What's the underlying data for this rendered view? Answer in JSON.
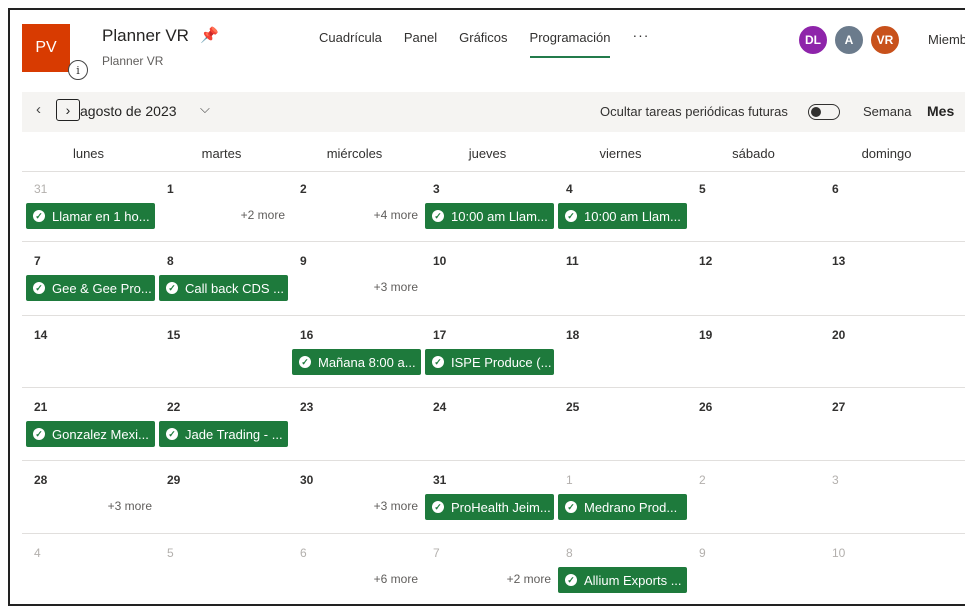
{
  "header": {
    "plan_icon_text": "PV",
    "plan_title": "Planner VR",
    "plan_subtitle": "Planner VR",
    "info_glyph": "i",
    "pin_glyph": "📌",
    "nav": [
      {
        "label": "Cuadrícula"
      },
      {
        "label": "Panel"
      },
      {
        "label": "Gráficos"
      },
      {
        "label": "Programación",
        "active": true
      }
    ],
    "more_glyph": "···",
    "avatars": [
      {
        "initials": "DL",
        "color": "#8e24aa"
      },
      {
        "initials": "A",
        "color": "#6b7b8c"
      },
      {
        "initials": "VR",
        "color": "#c8511b"
      }
    ],
    "members_label": "Miembros"
  },
  "toolbar": {
    "prev_glyph": "‹",
    "next_glyph": "›",
    "month_label": "agosto de 2023",
    "caret_glyph": "⌵",
    "hide_recurring_label": "Ocultar tareas periódicas futuras",
    "hide_recurring_on": false,
    "view_week": "Semana",
    "view_month": "Mes",
    "active_view": "Mes"
  },
  "calendar": {
    "days_of_week": [
      "lunes",
      "martes",
      "miércoles",
      "jueves",
      "viernes",
      "sábado",
      "domingo"
    ],
    "weeks": [
      {
        "days": [
          {
            "num": "31",
            "other": true
          },
          {
            "num": "1"
          },
          {
            "num": "2"
          },
          {
            "num": "3"
          },
          {
            "num": "4"
          },
          {
            "num": "5"
          },
          {
            "num": "6"
          }
        ],
        "more": [
          {
            "col": 1,
            "text": "+2 more"
          },
          {
            "col": 2,
            "text": "+4 more"
          }
        ],
        "tasks": [
          {
            "col": 0,
            "text": "Llamar en 1 ho..."
          },
          {
            "col": 3,
            "text": "10:00 am Llam..."
          },
          {
            "col": 4,
            "text": "10:00 am Llam..."
          }
        ]
      },
      {
        "days": [
          {
            "num": "7"
          },
          {
            "num": "8"
          },
          {
            "num": "9"
          },
          {
            "num": "10"
          },
          {
            "num": "11"
          },
          {
            "num": "12"
          },
          {
            "num": "13"
          }
        ],
        "more": [
          {
            "col": 2,
            "text": "+3 more"
          }
        ],
        "tasks": [
          {
            "col": 0,
            "text": "Gee & Gee Pro..."
          },
          {
            "col": 1,
            "text": "Call back CDS ..."
          }
        ]
      },
      {
        "days": [
          {
            "num": "14"
          },
          {
            "num": "15"
          },
          {
            "num": "16"
          },
          {
            "num": "17"
          },
          {
            "num": "18"
          },
          {
            "num": "19"
          },
          {
            "num": "20"
          }
        ],
        "more": [],
        "tasks": [
          {
            "col": 2,
            "text": "Mañana 8:00 a..."
          },
          {
            "col": 3,
            "text": "ISPE Produce (..."
          }
        ]
      },
      {
        "days": [
          {
            "num": "21"
          },
          {
            "num": "22"
          },
          {
            "num": "23"
          },
          {
            "num": "24"
          },
          {
            "num": "25"
          },
          {
            "num": "26"
          },
          {
            "num": "27"
          }
        ],
        "more": [],
        "tasks": [
          {
            "col": 0,
            "text": "Gonzalez Mexi..."
          },
          {
            "col": 1,
            "text": "Jade Trading - ..."
          }
        ]
      },
      {
        "days": [
          {
            "num": "28"
          },
          {
            "num": "29"
          },
          {
            "num": "30"
          },
          {
            "num": "31"
          },
          {
            "num": "1",
            "other": true
          },
          {
            "num": "2",
            "other": true
          },
          {
            "num": "3",
            "other": true
          }
        ],
        "more": [
          {
            "col": 0,
            "text": "+3 more"
          },
          {
            "col": 2,
            "text": "+3 more"
          }
        ],
        "tasks": [
          {
            "col": 3,
            "text": "ProHealth Jeim..."
          },
          {
            "col": 4,
            "text": "Medrano Prod..."
          }
        ]
      },
      {
        "days": [
          {
            "num": "4",
            "other": true
          },
          {
            "num": "5",
            "other": true
          },
          {
            "num": "6",
            "other": true
          },
          {
            "num": "7",
            "other": true
          },
          {
            "num": "8",
            "other": true
          },
          {
            "num": "9",
            "other": true
          },
          {
            "num": "10",
            "other": true
          }
        ],
        "more": [
          {
            "col": 2,
            "text": "+6 more"
          },
          {
            "col": 3,
            "text": "+2 more"
          }
        ],
        "tasks": [
          {
            "col": 4,
            "text": "Allium Exports ..."
          }
        ]
      }
    ]
  },
  "colors": {
    "task_green": "#1e7a3c",
    "plan_icon": "#d83b01",
    "active_underline": "#237b4b"
  }
}
